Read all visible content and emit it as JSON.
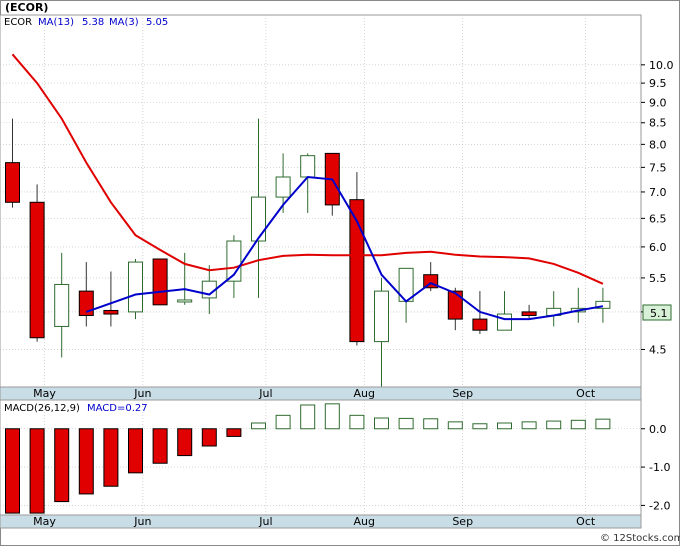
{
  "title": "(ECOR)",
  "watermark": "© 12Stocks.com",
  "colors": {
    "up": "#2e6b2e",
    "down": "#e00000",
    "ma_long": "#e00000",
    "ma_short": "#0000cc",
    "axis_band": "#c9dde7",
    "grid": "#bbbbbb",
    "last_badge_bg": "#d8f0d8",
    "last_badge_border": "#2e6b2e"
  },
  "chart_data": [
    {
      "type": "candlestick",
      "scale": "log",
      "legend": {
        "symbol": "ECOR",
        "ma13_label": "MA(13)",
        "ma13_value": "5.38",
        "ma3_label": "MA(3)",
        "ma3_value": "5.05"
      },
      "last_value": "5.1",
      "ylim": [
        4.05,
        11.5
      ],
      "yticks": [
        4.5,
        5.0,
        5.5,
        6.0,
        6.5,
        7.0,
        7.5,
        8.0,
        8.5,
        9.0,
        9.5,
        10.0
      ],
      "ytick_labels": [
        "4.5",
        "5.0",
        "5.5",
        "6.0",
        "6.5",
        "7.0",
        "7.5",
        "8.0",
        "8.5",
        "9.0",
        "9.5",
        "10.0"
      ],
      "month_labels": [
        "May",
        "Jun",
        "Jul",
        "Aug",
        "Sep",
        "Oct"
      ],
      "month_index": [
        1.3,
        5.3,
        10.3,
        14.3,
        18.3,
        23.3
      ],
      "candles": [
        {
          "o": 7.6,
          "h": 8.6,
          "l": 6.7,
          "c": 6.8
        },
        {
          "o": 6.8,
          "h": 7.15,
          "l": 4.6,
          "c": 4.65
        },
        {
          "o": 4.8,
          "h": 5.9,
          "l": 4.4,
          "c": 5.4
        },
        {
          "o": 5.3,
          "h": 5.75,
          "l": 4.8,
          "c": 4.95
        },
        {
          "o": 5.02,
          "h": 5.6,
          "l": 4.8,
          "c": 4.97
        },
        {
          "o": 5.0,
          "h": 5.8,
          "l": 4.9,
          "c": 5.75
        },
        {
          "o": 5.8,
          "h": 5.8,
          "l": 5.1,
          "c": 5.1
        },
        {
          "o": 5.15,
          "h": 5.9,
          "l": 5.1,
          "c": 5.17
        },
        {
          "o": 5.2,
          "h": 5.7,
          "l": 4.97,
          "c": 5.45
        },
        {
          "o": 5.45,
          "h": 6.2,
          "l": 5.2,
          "c": 6.1
        },
        {
          "o": 6.1,
          "h": 8.6,
          "l": 5.2,
          "c": 6.9
        },
        {
          "o": 6.9,
          "h": 7.8,
          "l": 6.6,
          "c": 7.3
        },
        {
          "o": 7.3,
          "h": 7.8,
          "l": 6.6,
          "c": 7.75
        },
        {
          "o": 7.8,
          "h": 7.8,
          "l": 6.55,
          "c": 6.75
        },
        {
          "o": 6.85,
          "h": 7.4,
          "l": 4.55,
          "c": 4.6
        },
        {
          "o": 4.6,
          "h": 5.5,
          "l": 4.05,
          "c": 5.3
        },
        {
          "o": 5.15,
          "h": 5.65,
          "l": 4.85,
          "c": 5.65
        },
        {
          "o": 5.55,
          "h": 5.75,
          "l": 5.3,
          "c": 5.35
        },
        {
          "o": 5.3,
          "h": 5.35,
          "l": 4.75,
          "c": 4.9
        },
        {
          "o": 4.9,
          "h": 5.3,
          "l": 4.7,
          "c": 4.75
        },
        {
          "o": 4.75,
          "h": 5.3,
          "l": 4.75,
          "c": 4.97
        },
        {
          "o": 5.0,
          "h": 5.1,
          "l": 4.9,
          "c": 4.95
        },
        {
          "o": 4.95,
          "h": 5.3,
          "l": 4.8,
          "c": 5.05
        },
        {
          "o": 5.0,
          "h": 5.35,
          "l": 4.85,
          "c": 5.05
        },
        {
          "o": 5.05,
          "h": 5.35,
          "l": 4.85,
          "c": 5.15
        }
      ],
      "ma13": [
        [
          0,
          10.3
        ],
        [
          1,
          9.5
        ],
        [
          2,
          8.6
        ],
        [
          3,
          7.6
        ],
        [
          4,
          6.8
        ],
        [
          5,
          6.2
        ],
        [
          6,
          5.95
        ],
        [
          7,
          5.72
        ],
        [
          8,
          5.62
        ],
        [
          9,
          5.66
        ],
        [
          10,
          5.78
        ],
        [
          11,
          5.85
        ],
        [
          12,
          5.87
        ],
        [
          13,
          5.86
        ],
        [
          14,
          5.86
        ],
        [
          15,
          5.86
        ],
        [
          16,
          5.9
        ],
        [
          17,
          5.92
        ],
        [
          18,
          5.87
        ],
        [
          19,
          5.84
        ],
        [
          20,
          5.83
        ],
        [
          21,
          5.81
        ],
        [
          22,
          5.72
        ],
        [
          23,
          5.58
        ],
        [
          24,
          5.41
        ]
      ],
      "ma3": [
        [
          3,
          5.0
        ],
        [
          5,
          5.25
        ],
        [
          7,
          5.33
        ],
        [
          8,
          5.25
        ],
        [
          9,
          5.55
        ],
        [
          10,
          6.15
        ],
        [
          11,
          6.75
        ],
        [
          12,
          7.3
        ],
        [
          13,
          7.25
        ],
        [
          14,
          6.45
        ],
        [
          15,
          5.55
        ],
        [
          16,
          5.15
        ],
        [
          17,
          5.42
        ],
        [
          18,
          5.27
        ],
        [
          19,
          5.0
        ],
        [
          20,
          4.9
        ],
        [
          21,
          4.9
        ],
        [
          22,
          4.95
        ],
        [
          23,
          5.02
        ],
        [
          24,
          5.08
        ]
      ]
    },
    {
      "type": "bar",
      "legend": {
        "label": "MACD(26,12,9)",
        "value_label": "MACD=0.27"
      },
      "ylim": [
        -2.25,
        0.75
      ],
      "yticks": [
        0.0,
        -1.0,
        -2.0
      ],
      "ytick_labels": [
        "0.0",
        "-1.0",
        "-2.0"
      ],
      "month_labels": [
        "May",
        "Jun",
        "Jul",
        "Aug",
        "Sep",
        "Oct"
      ],
      "values": [
        -2.2,
        -2.2,
        -1.9,
        -1.7,
        -1.5,
        -1.15,
        -0.9,
        -0.7,
        -0.45,
        -0.2,
        0.15,
        0.35,
        0.62,
        0.65,
        0.35,
        0.28,
        0.27,
        0.26,
        0.18,
        0.13,
        0.15,
        0.18,
        0.2,
        0.22,
        0.25
      ]
    }
  ]
}
